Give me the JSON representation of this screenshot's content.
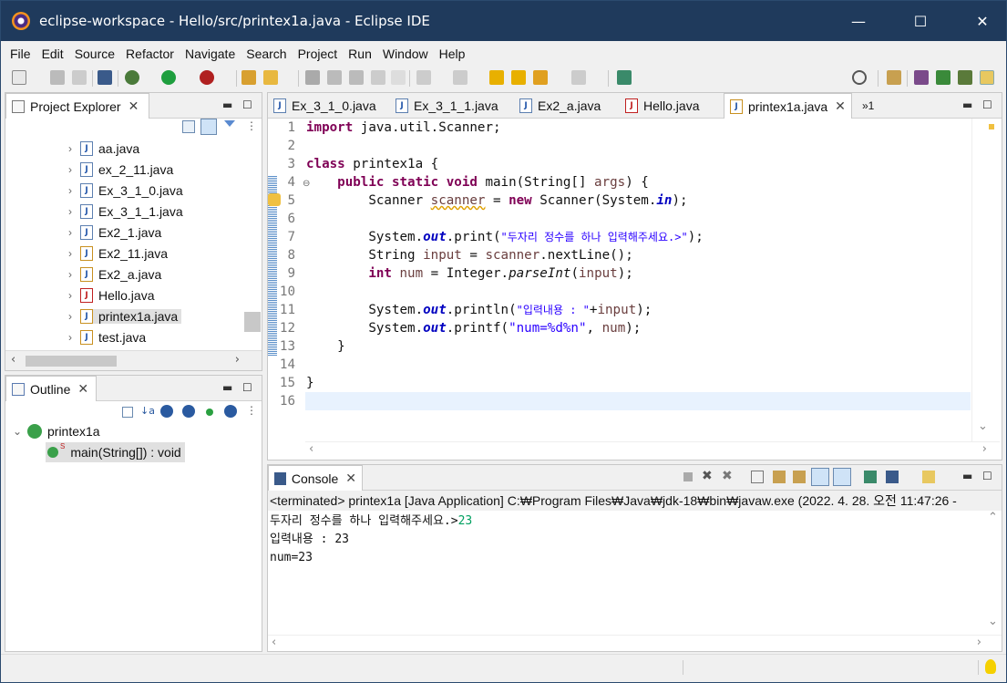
{
  "window": {
    "title": "eclipse-workspace - Hello/src/printex1a.java - Eclipse IDE",
    "minimize": "—",
    "maximize": "☐",
    "close": "✕"
  },
  "menu": [
    "File",
    "Edit",
    "Source",
    "Refactor",
    "Navigate",
    "Search",
    "Project",
    "Run",
    "Window",
    "Help"
  ],
  "project_explorer": {
    "tab_label": "Project Explorer",
    "items": [
      {
        "label": "aa.java"
      },
      {
        "label": "ex_2_11.java"
      },
      {
        "label": "Ex_3_1_0.java"
      },
      {
        "label": "Ex_3_1_1.java"
      },
      {
        "label": "Ex2_1.java"
      },
      {
        "label": "Ex2_11.java"
      },
      {
        "label": "Ex2_a.java"
      },
      {
        "label": "Hello.java"
      },
      {
        "label": "printex1a.java"
      },
      {
        "label": "test.java"
      }
    ]
  },
  "outline": {
    "tab_label": "Outline",
    "class_name": "printex1a",
    "method": "main(String[]) : void"
  },
  "editor": {
    "tabs": [
      "Ex_3_1_0.java",
      "Ex_3_1_1.java",
      "Ex2_a.java",
      "Hello.java",
      "printex1a.java"
    ],
    "overflow": "»1",
    "lines": [
      "1",
      "2",
      "3",
      "4",
      "5",
      "6",
      "7",
      "8",
      "9",
      "10",
      "11",
      "12",
      "13",
      "14",
      "15",
      "16"
    ],
    "code": {
      "l1_kw": "import",
      "l1_rest": " java.util.Scanner;",
      "l3_kw": "class",
      "l3_rest": " printex1a {",
      "l4_a": "    ",
      "l4_kw1": "public static void",
      "l4_rest": " main(String[] ",
      "l4_args": "args",
      "l4_end": ") {",
      "l5_a": "        Scanner ",
      "l5_var": "scanner",
      "l5_b": " = ",
      "l5_kw": "new",
      "l5_c": " Scanner(System.",
      "l5_in": "in",
      "l5_end": ");",
      "l7_a": "        System.",
      "l7_out": "out",
      "l7_b": ".print(",
      "l7_str": "\"두자리 정수를 하나 입력해주세요.>\"",
      "l7_end": ");",
      "l8_a": "        String ",
      "l8_var": "input",
      "l8_b": " = ",
      "l8_var2": "scanner",
      "l8_end": ".nextLine();",
      "l9_a": "        ",
      "l9_kw": "int",
      "l9_b": " ",
      "l9_var": "num",
      "l9_c": " = Integer.",
      "l9_it": "parseInt",
      "l9_d": "(",
      "l9_var2": "input",
      "l9_end": ");",
      "l11_a": "        System.",
      "l11_out": "out",
      "l11_b": ".println(",
      "l11_str": "\"입력내용 : \"",
      "l11_c": "+",
      "l11_var": "input",
      "l11_end": ");",
      "l12_a": "        System.",
      "l12_out": "out",
      "l12_b": ".printf(",
      "l12_str": "\"num=%d%n\"",
      "l12_c": ", ",
      "l12_var": "num",
      "l12_end": ");",
      "l13": "    }",
      "l15": "}"
    }
  },
  "console": {
    "tab_label": "Console",
    "status": "<terminated> printex1a [Java Application] C:₩Program Files₩Java₩jdk-18₩bin₩javaw.exe  (2022. 4. 28. 오전 11:47:26 -",
    "prompt": "두자리 정수를 하나 입력해주세요.>",
    "user_input": "23",
    "line2": "입력내용 : 23",
    "line3": "num=23"
  },
  "colors": {
    "keyword": "#7f0055",
    "string": "#2a00ff",
    "field": "#0000c0",
    "input_echo": "#00a060",
    "titlebar": "#1f3a5c"
  }
}
